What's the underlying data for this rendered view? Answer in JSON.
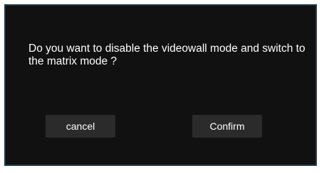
{
  "dialog": {
    "message": "Do you want to disable the videowall mode and switch to the matrix mode ?",
    "cancel_label": "cancel",
    "confirm_label": "Confirm"
  },
  "colors": {
    "dialog_background": "#111111",
    "dialog_border": "#1f3a4a",
    "button_background": "#2b2b2b",
    "text": "#ffffff"
  }
}
